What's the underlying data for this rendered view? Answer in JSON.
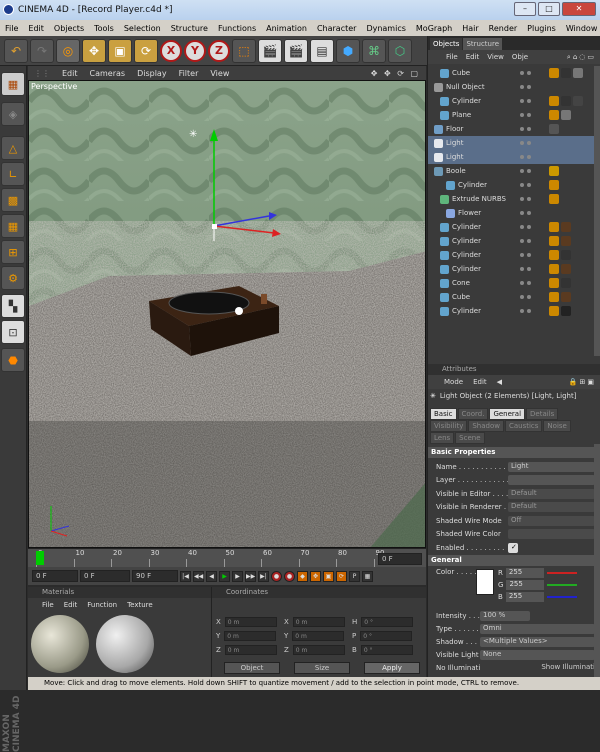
{
  "window": {
    "title": "CINEMA 4D - [Record Player.c4d *]",
    "buttons": [
      "–",
      "□",
      "✕"
    ]
  },
  "menubar": [
    "File",
    "Edit",
    "Objects",
    "Tools",
    "Selection",
    "Structure",
    "Functions",
    "Animation",
    "Character",
    "Dynamics",
    "MoGraph",
    "Hair",
    "Render",
    "Plugins",
    "Window",
    "Help"
  ],
  "toolbar": {
    "icons": [
      "undo-icon",
      "redo-icon",
      "live-select-icon",
      "move-icon",
      "scale-icon",
      "rotate-icon",
      "x-axis-icon",
      "y-axis-icon",
      "z-axis-icon",
      "world-coords-icon",
      "render-view-icon",
      "render-picture-icon",
      "edit-render-settings-icon",
      "cube-primitive-icon",
      "nurbs-icon",
      "array-icon"
    ],
    "x": "X",
    "y": "Y",
    "z": "Z"
  },
  "viewport": {
    "menu": [
      "Edit",
      "Cameras",
      "Display",
      "Filter",
      "View"
    ],
    "label": "Perspective"
  },
  "timeline": {
    "ticks": [
      "0",
      "10",
      "20",
      "30",
      "40",
      "50",
      "60",
      "70",
      "80",
      "90"
    ],
    "frame": "0 F"
  },
  "time_controls": {
    "start": "0 F",
    "mid": "0 F",
    "end": "90 F"
  },
  "materials": {
    "header": "Materials",
    "menu": [
      "File",
      "Edit",
      "Function",
      "Texture"
    ]
  },
  "coordinates": {
    "header": "Coordinates",
    "rows": [
      {
        "a": "X",
        "av": "0 m",
        "b": "X",
        "bv": "0 m",
        "c": "H",
        "cv": "0 °"
      },
      {
        "a": "Y",
        "av": "0 m",
        "b": "Y",
        "bv": "0 m",
        "c": "P",
        "cv": "0 °"
      },
      {
        "a": "Z",
        "av": "0 m",
        "b": "Z",
        "bv": "0 m",
        "c": "B",
        "cv": "0 °"
      }
    ],
    "mode": "Object",
    "size": "Size",
    "apply": "Apply"
  },
  "objects": {
    "tabs": [
      "Objects",
      "Structure"
    ],
    "menu": [
      "File",
      "Edit",
      "View",
      "Obje"
    ],
    "items": [
      {
        "name": "Cube",
        "indent": 1
      },
      {
        "name": "Null Object",
        "indent": 0
      },
      {
        "name": "Cylinder",
        "indent": 1
      },
      {
        "name": "Plane",
        "indent": 1
      },
      {
        "name": "Floor",
        "indent": 0
      },
      {
        "name": "Light",
        "indent": 0
      },
      {
        "name": "Light",
        "indent": 0
      },
      {
        "name": "Boole",
        "indent": 0
      },
      {
        "name": "Cylinder",
        "indent": 2
      },
      {
        "name": "Extrude NURBS",
        "indent": 1
      },
      {
        "name": "Flower",
        "indent": 2
      },
      {
        "name": "Cylinder",
        "indent": 1
      },
      {
        "name": "Cylinder",
        "indent": 1
      },
      {
        "name": "Cylinder",
        "indent": 1
      },
      {
        "name": "Cylinder",
        "indent": 1
      },
      {
        "name": "Cone",
        "indent": 1
      },
      {
        "name": "Cube",
        "indent": 1
      },
      {
        "name": "Cylinder",
        "indent": 1
      }
    ]
  },
  "attributes": {
    "header": "Attributes",
    "menu": [
      "Mode",
      "Edit"
    ],
    "title": "Light Object (2 Elements) [Light, Light]",
    "tabs1": [
      "Basic",
      "Coord.",
      "General",
      "Details"
    ],
    "tabs2": [
      "Visibility",
      "Shadow",
      "Caustics",
      "Noise"
    ],
    "tabs3": [
      "Lens",
      "Scene"
    ],
    "basic_header": "Basic Properties",
    "basic": [
      {
        "label": "Name . . . . . . . . . . . .",
        "value": "Light"
      },
      {
        "label": "Layer . . . . . . . . . . . .",
        "value": ""
      },
      {
        "label": "Visible in Editor . . . . .",
        "value": "Default"
      },
      {
        "label": "Visible in Renderer . . .",
        "value": "Default"
      },
      {
        "label": "Shaded Wire Mode",
        "value": "Off"
      },
      {
        "label": "Shaded Wire Color",
        "value": ""
      },
      {
        "label": "Enabled . . . . . . . . .",
        "value": "✓"
      }
    ],
    "general_header": "General",
    "color_label": "Color . . . . .",
    "rgb": [
      {
        "c": "R",
        "v": "255"
      },
      {
        "c": "G",
        "v": "255"
      },
      {
        "c": "B",
        "v": "255"
      }
    ],
    "general": [
      {
        "label": "Intensity . . . .",
        "value": "100 %"
      },
      {
        "label": "Type . . . . . . .",
        "value": "Omni"
      },
      {
        "label": "Shadow . . . . .",
        "value": "<Multiple Values>"
      },
      {
        "label": "Visible Light",
        "value": "None"
      },
      {
        "label": "No Illumination",
        "value": "Show Illuminati"
      }
    ]
  },
  "status": "Move: Click and drag to move elements. Hold down SHIFT to quantize movement / add to the selection in point mode, CTRL to remove.",
  "brand": "MAXON CINEMA 4D",
  "colors": {
    "accent": "#d0a000",
    "select": "#a8c8ff"
  }
}
